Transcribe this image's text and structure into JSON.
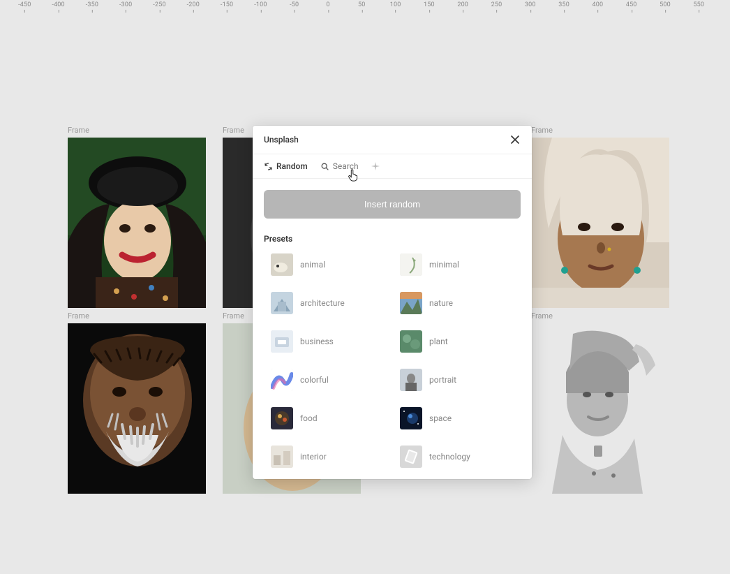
{
  "ruler": {
    "ticks": [
      "-450",
      "-400",
      "-350",
      "-300",
      "-250",
      "-200",
      "-150",
      "-100",
      "-50",
      "0",
      "50",
      "100",
      "150",
      "200",
      "250",
      "300",
      "350",
      "400",
      "450",
      "500",
      "550"
    ]
  },
  "frames": {
    "label": "Frame"
  },
  "modal": {
    "title": "Unsplash",
    "tabs": {
      "random": "Random",
      "search": "Search"
    },
    "insert_button": "Insert random",
    "presets_title": "Presets",
    "presets": [
      {
        "key": "animal",
        "label": "animal"
      },
      {
        "key": "minimal",
        "label": "minimal"
      },
      {
        "key": "architecture",
        "label": "architecture"
      },
      {
        "key": "nature",
        "label": "nature"
      },
      {
        "key": "business",
        "label": "business"
      },
      {
        "key": "plant",
        "label": "plant"
      },
      {
        "key": "colorful",
        "label": "colorful"
      },
      {
        "key": "portrait",
        "label": "portrait"
      },
      {
        "key": "food",
        "label": "food"
      },
      {
        "key": "space",
        "label": "space"
      },
      {
        "key": "interior",
        "label": "interior"
      },
      {
        "key": "technology",
        "label": "technology"
      }
    ]
  }
}
